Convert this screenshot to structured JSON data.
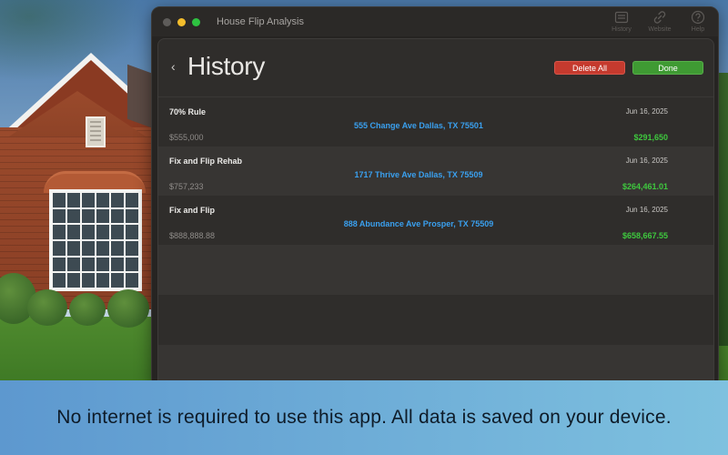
{
  "window": {
    "title": "House Flip Analysis",
    "toolbar": [
      {
        "label": "History",
        "icon": "history-icon"
      },
      {
        "label": "Website",
        "icon": "link-icon"
      },
      {
        "label": "Help",
        "icon": "help-icon"
      }
    ]
  },
  "sheet": {
    "title": "History",
    "back_glyph": "‹",
    "delete_label": "Delete All",
    "done_label": "Done"
  },
  "history": [
    {
      "name": "70% Rule",
      "date": "Jun 16, 2025",
      "address": "555 Change Ave Dallas, TX 75501",
      "price": "$555,000",
      "profit": "$291,650"
    },
    {
      "name": "Fix and Flip Rehab",
      "date": "Jun 16, 2025",
      "address": "1717 Thrive Ave Dallas, TX 75509",
      "price": "$757,233",
      "profit": "$264,461.01"
    },
    {
      "name": "Fix and Flip",
      "date": "Jun 16, 2025",
      "address": "888 Abundance Ave Prosper, TX 75509",
      "price": "$888,888.88",
      "profit": "$658,667.55"
    }
  ],
  "caption": "No internet is required to use this app. All data is saved on your device.",
  "colors": {
    "delete": "#c53a2e",
    "done": "#3f9a33",
    "address": "#3aa0ef",
    "profit": "#3ec83e"
  }
}
